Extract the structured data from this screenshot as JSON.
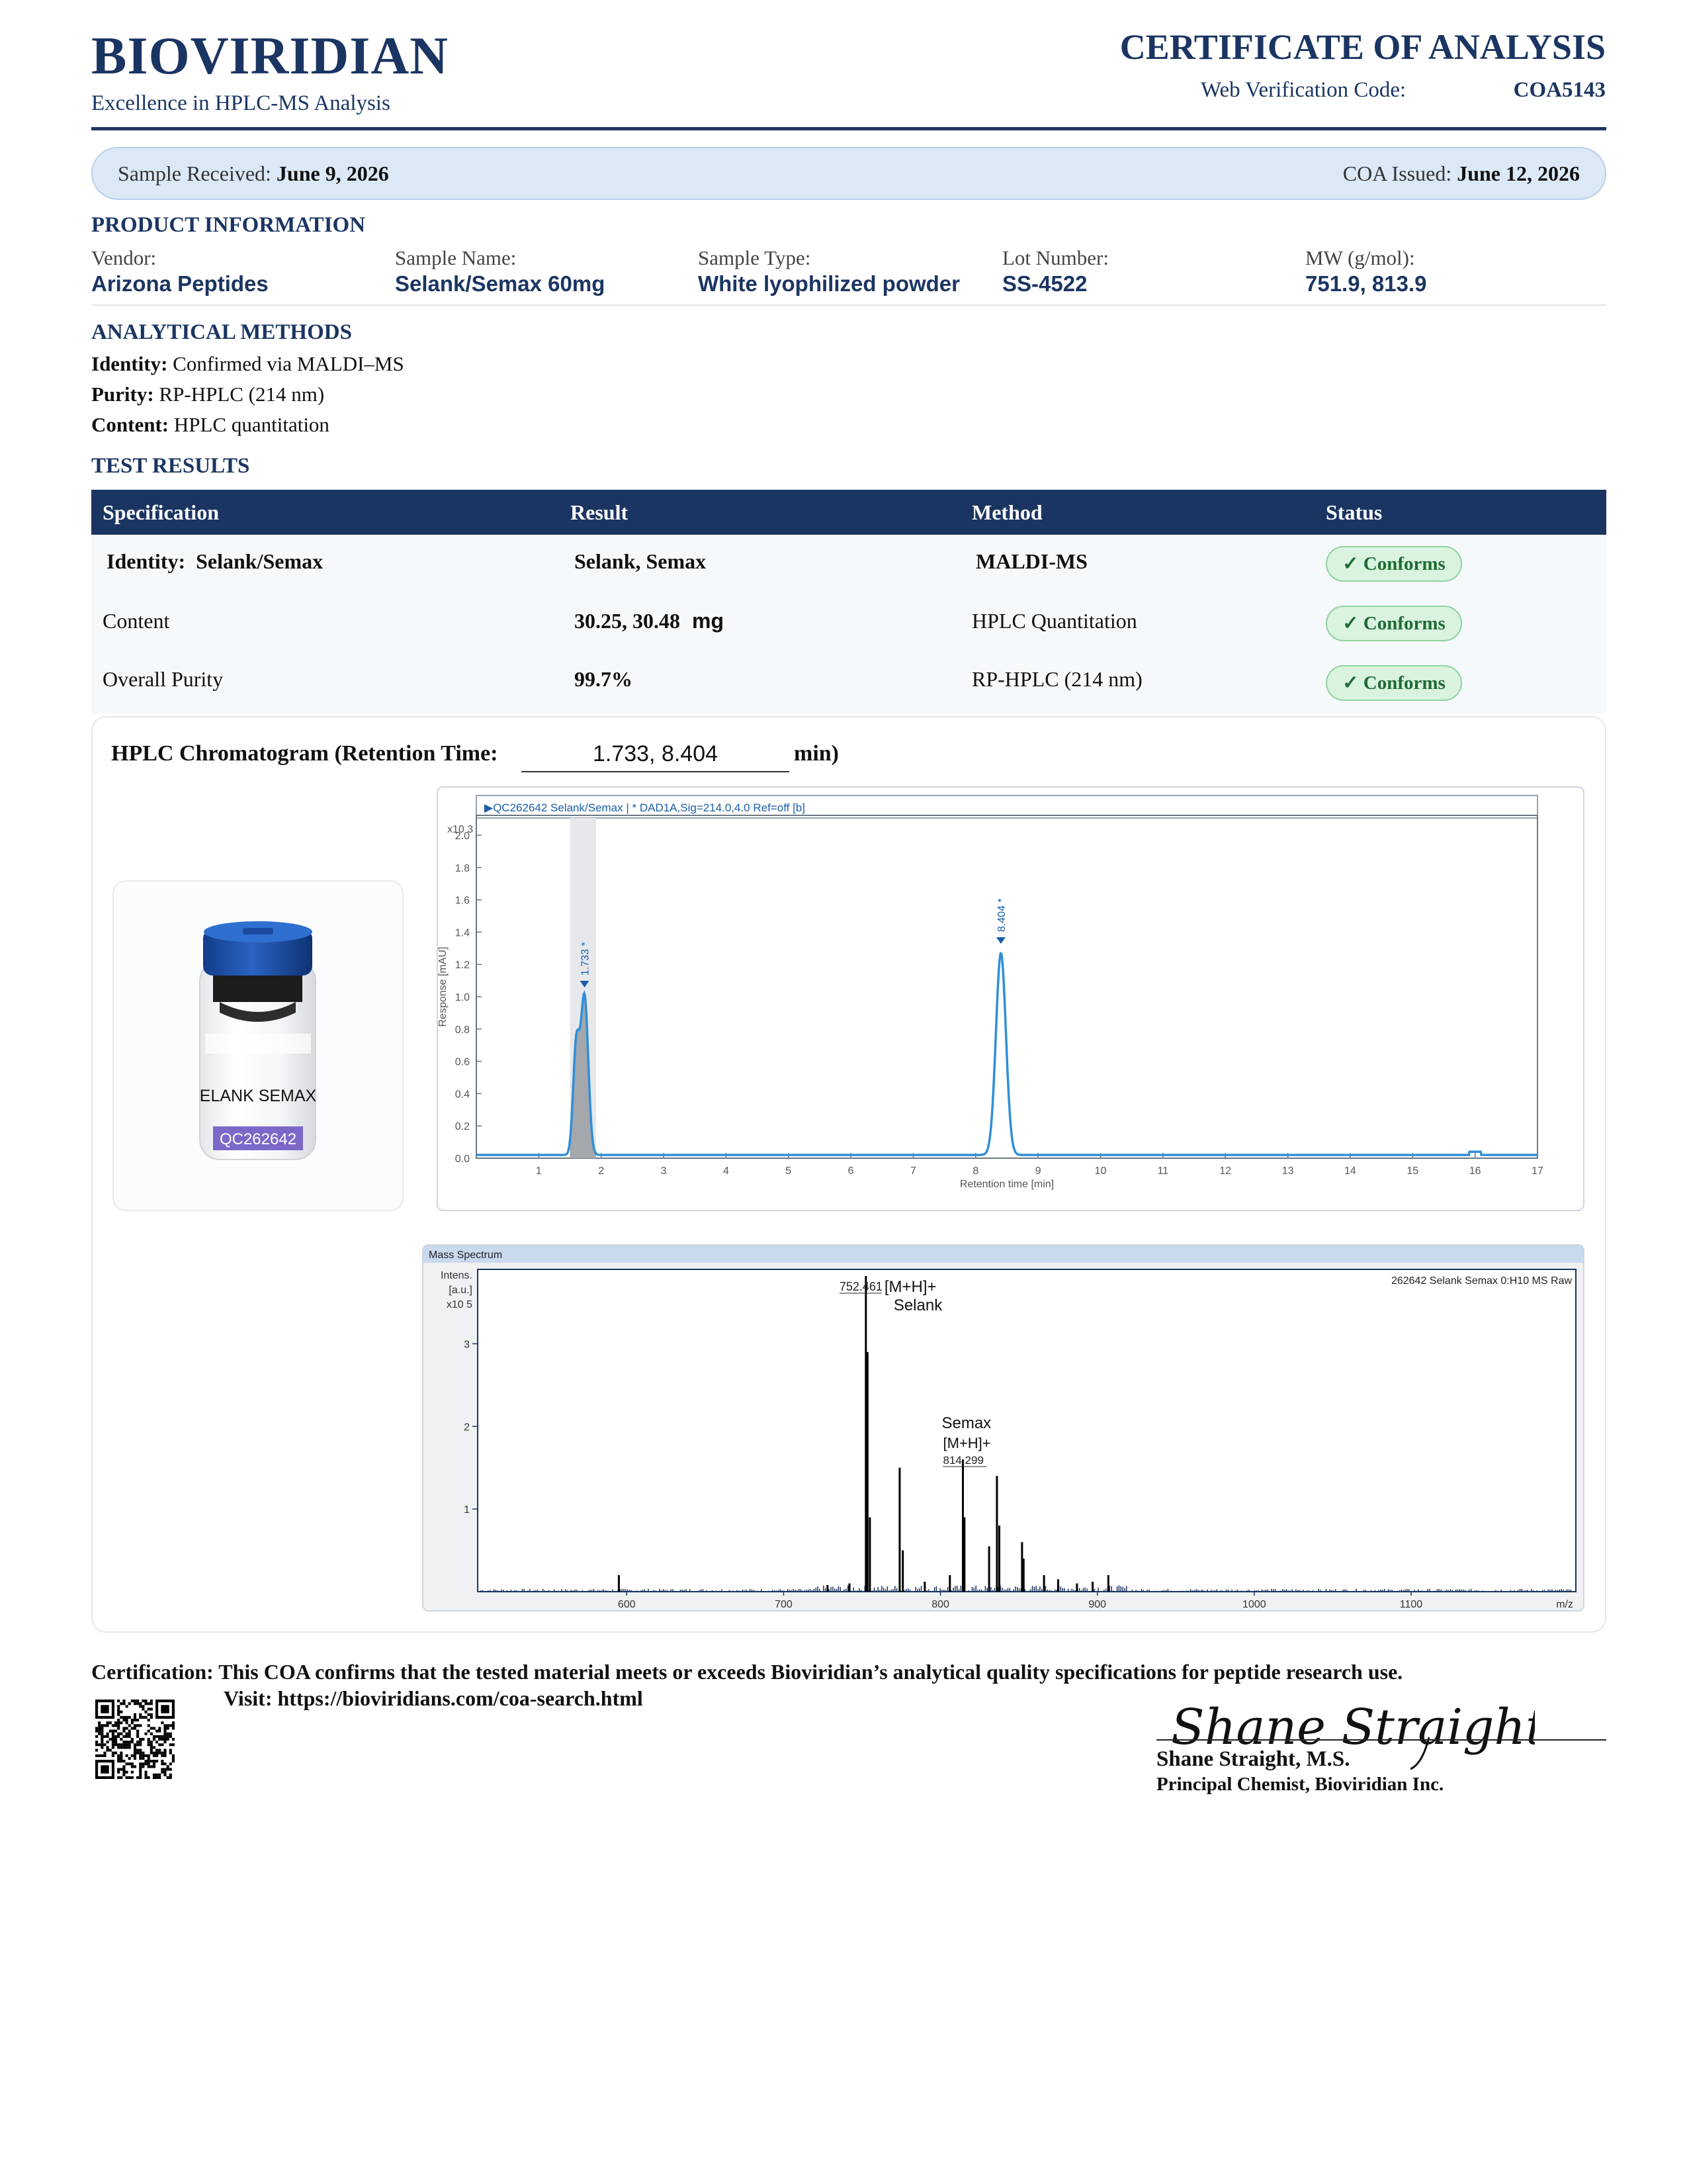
{
  "header": {
    "brand": "BIOVIRIDIAN",
    "tagline": "Excellence in HPLC-MS Analysis",
    "doc_title": "CERTIFICATE OF ANALYSIS",
    "verification_label": "Web Verification Code:",
    "verification_code": "COA5143"
  },
  "dates": {
    "received_label": "Sample Received:",
    "received_value": "June 9, 2026",
    "issued_label": "COA Issued:",
    "issued_value": "June 12, 2026"
  },
  "product_info": {
    "title": "PRODUCT INFORMATION",
    "fields": [
      {
        "label": "Vendor:",
        "value": "Arizona Peptides"
      },
      {
        "label": "Sample Name:",
        "value": "Selank/Semax 60mg"
      },
      {
        "label": "Sample Type:",
        "value": "White lyophilized powder"
      },
      {
        "label": "Lot Number:",
        "value": "SS-4522"
      },
      {
        "label": "MW (g/mol):",
        "value": "751.9, 813.9"
      }
    ]
  },
  "methods": {
    "title": "ANALYTICAL METHODS",
    "items": [
      {
        "label": "Identity:",
        "value": "Confirmed via MALDI–MS"
      },
      {
        "label": "Purity:",
        "value": "RP-HPLC (214 nm)"
      },
      {
        "label": "Content:",
        "value": "HPLC quantitation"
      }
    ]
  },
  "results": {
    "title": "TEST RESULTS",
    "columns": [
      "Specification",
      "Result",
      "Method",
      "Status"
    ],
    "rows": [
      {
        "spec_label": "Identity:",
        "spec_value": "Selank/Semax",
        "result": "Selank, Semax",
        "result_unit": "",
        "method": "MALDI-MS",
        "status": "✓ Conforms"
      },
      {
        "spec_label": "Content",
        "spec_value": "",
        "result": "30.25, 30.48",
        "result_unit": "mg",
        "method": "HPLC Quantitation",
        "status": "✓ Conforms"
      },
      {
        "spec_label": "Overall Purity",
        "spec_value": "",
        "result": "99.7%",
        "result_unit": "",
        "method": "RP-HPLC (214 nm)",
        "status": "✓ Conforms"
      }
    ]
  },
  "chromatogram": {
    "label": "HPLC Chromatogram (Retention Time:",
    "retention_times": "1.733, 8.404",
    "unit": "min)"
  },
  "vial": {
    "label": "ELANK  SEMAX",
    "code": "QC262642"
  },
  "chart_data": [
    {
      "type": "line",
      "header": "QC262642 Selank/Semax | * DAD1A,Sig=214.0,4.0 Ref=off [b]",
      "y_multiplier": "x10 3",
      "ylabel": "Response [mAU]",
      "xlabel": "Retention time [min]",
      "xlim": [
        0,
        17
      ],
      "ylim": [
        0,
        2.0
      ],
      "x_ticks": [
        1,
        2,
        3,
        4,
        5,
        6,
        7,
        8,
        9,
        10,
        11,
        12,
        13,
        14,
        15,
        16,
        17
      ],
      "y_ticks": [
        "0.0",
        "0.2",
        "0.4",
        "0.6",
        "0.8",
        "1.0",
        "1.2",
        "1.4",
        "1.6",
        "1.8",
        "2.0"
      ],
      "peaks": [
        {
          "x": 1.6,
          "y": 0.66,
          "width": 0.05,
          "label": ""
        },
        {
          "x": 1.733,
          "y": 0.98,
          "width": 0.06,
          "label": "1.733 *"
        },
        {
          "x": 8.404,
          "y": 1.25,
          "width": 0.08,
          "label": "8.404 *"
        }
      ],
      "baseline": 0.02
    },
    {
      "type": "bar",
      "title": "Mass Spectrum",
      "file_label": "262642 Selank Semax 0:H10 MS Raw",
      "ylabel_lines": [
        "Intens.",
        "[a.u.]",
        "x10 5"
      ],
      "xlabel": "m/z",
      "xlim": [
        505,
        1205
      ],
      "ylim": [
        0,
        3.9
      ],
      "x_ticks": [
        600,
        700,
        800,
        900,
        1000,
        1100
      ],
      "y_ticks": [
        1,
        2,
        3
      ],
      "peaks": [
        {
          "x": 595,
          "y": 0.2
        },
        {
          "x": 728,
          "y": 0.08
        },
        {
          "x": 742,
          "y": 0.1
        },
        {
          "x": 752.461,
          "y": 3.82
        },
        {
          "x": 753.5,
          "y": 2.9
        },
        {
          "x": 755,
          "y": 0.9
        },
        {
          "x": 774,
          "y": 1.5
        },
        {
          "x": 776,
          "y": 0.5
        },
        {
          "x": 790,
          "y": 0.12
        },
        {
          "x": 806,
          "y": 0.2
        },
        {
          "x": 814.299,
          "y": 1.6
        },
        {
          "x": 815.3,
          "y": 0.9
        },
        {
          "x": 831,
          "y": 0.55
        },
        {
          "x": 836,
          "y": 1.4
        },
        {
          "x": 837.5,
          "y": 0.8
        },
        {
          "x": 852,
          "y": 0.6
        },
        {
          "x": 853,
          "y": 0.4
        },
        {
          "x": 866,
          "y": 0.2
        },
        {
          "x": 875,
          "y": 0.15
        },
        {
          "x": 887,
          "y": 0.1
        },
        {
          "x": 897,
          "y": 0.12
        },
        {
          "x": 907,
          "y": 0.2
        }
      ],
      "annotations": [
        {
          "x": 752.461,
          "mass": "752.461",
          "ion": "[M+H]+",
          "name": "Selank"
        },
        {
          "x": 814.299,
          "mass": "814.299",
          "ion": "[M+H]+",
          "name": "Semax"
        }
      ]
    }
  ],
  "footer": {
    "certification_label": "Certification:",
    "certification_text": "This COA confirms that the tested material meets or exceeds Bioviridian’s analytical quality specifications for peptide research use.",
    "visit_label": "Visit:",
    "visit_url": "https://bioviridians.com/coa-search.html",
    "signature_script": "Shane Straight",
    "signer_name": "Shane Straight, M.S.",
    "signer_title": "Principal Chemist, Bioviridian Inc."
  }
}
